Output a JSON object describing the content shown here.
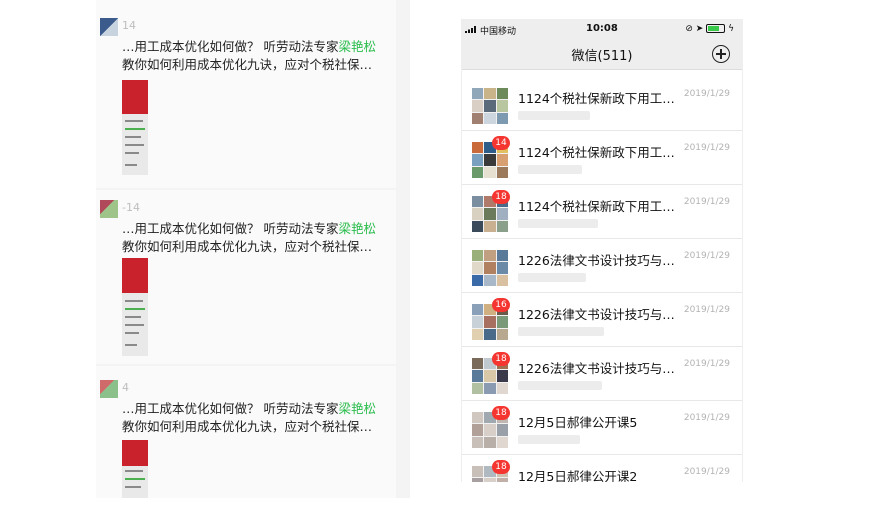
{
  "moments": {
    "posts": [
      {
        "name": "14",
        "line1": "…用工成本优化如何做？ 听劳动法专家",
        "highlight": "梁艳松",
        "line2": "教你如何利用成本优化九诀，应对个税社保…"
      },
      {
        "name": "-14",
        "line1": "…用工成本优化如何做？ 听劳动法专家",
        "highlight": "梁艳松",
        "line2": "教你如何利用成本优化九诀，应对个税社保…"
      },
      {
        "name": "4",
        "line1": "…用工成本优化如何做？ 听劳动法专家",
        "highlight": "梁艳松",
        "line2": "教你如何利用成本优化九诀，应对个税社保…"
      }
    ],
    "highlight_color": "#2dbd4e"
  },
  "phone": {
    "status": {
      "carrier": "中国移动",
      "time": "10:08"
    },
    "title": "微信(511)",
    "chats": [
      {
        "title": "1124个税社保新政下用工…",
        "date": "2019/1/29",
        "badge": ""
      },
      {
        "title": "1124个税社保新政下用工…",
        "date": "2019/1/29",
        "badge": "14"
      },
      {
        "title": "1124个税社保新政下用工…",
        "date": "2019/1/29",
        "badge": "18"
      },
      {
        "title": "1226法律文书设计技巧与…",
        "date": "2019/1/29",
        "badge": ""
      },
      {
        "title": "1226法律文书设计技巧与…",
        "date": "2019/1/29",
        "badge": "16"
      },
      {
        "title": "1226法律文书设计技巧与…",
        "date": "2019/1/29",
        "badge": "18"
      },
      {
        "title": "12月5日郝律公开课5",
        "date": "2019/1/29",
        "badge": "18"
      },
      {
        "title": "12月5日郝律公开课2",
        "date": "2019/1/29",
        "badge": "18"
      }
    ],
    "badge_color": "#f43530"
  }
}
